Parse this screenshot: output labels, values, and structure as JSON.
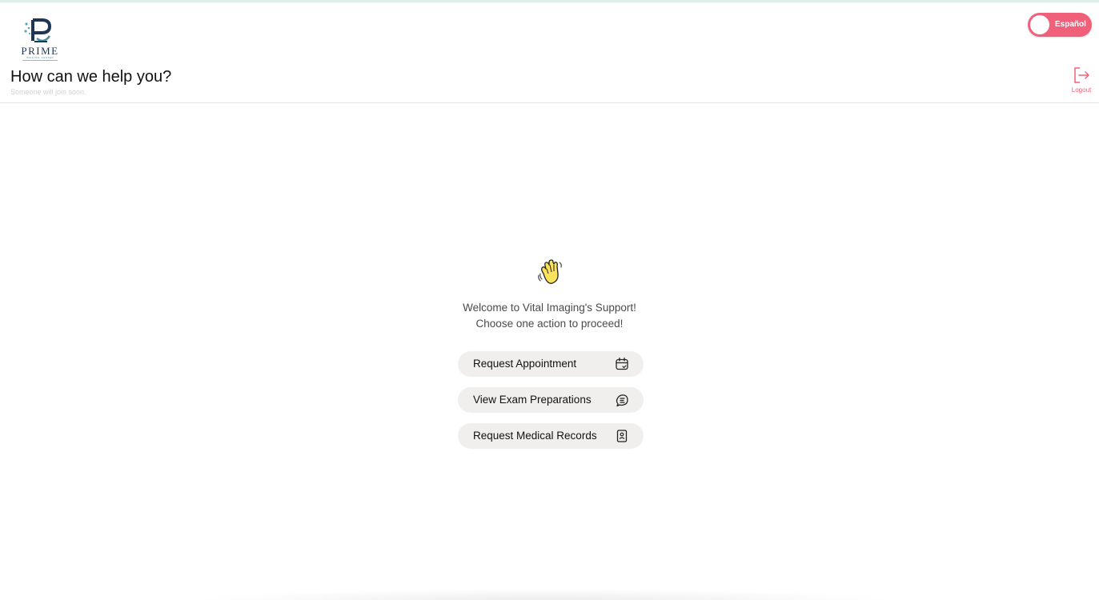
{
  "brand": {
    "logo_word": "PRIME",
    "logo_tagline": "IMAGING CENTER",
    "accent_color": "#f0607a",
    "navy_color": "#1e3553"
  },
  "header": {
    "title": "How can we help you?",
    "subtitle": "Someone will join soon.",
    "language_toggle_label": "Español",
    "logout_label": "Logout"
  },
  "welcome": {
    "icon": "waving-hand-icon",
    "line1": "Welcome to Vital Imaging's Support!",
    "line2": "Choose one action to proceed!"
  },
  "actions": [
    {
      "label": "Request Appointment",
      "icon": "calendar-icon"
    },
    {
      "label": "View Exam Preparations",
      "icon": "exam-prep-icon"
    },
    {
      "label": "Request Medical Records",
      "icon": "medical-record-icon"
    }
  ]
}
